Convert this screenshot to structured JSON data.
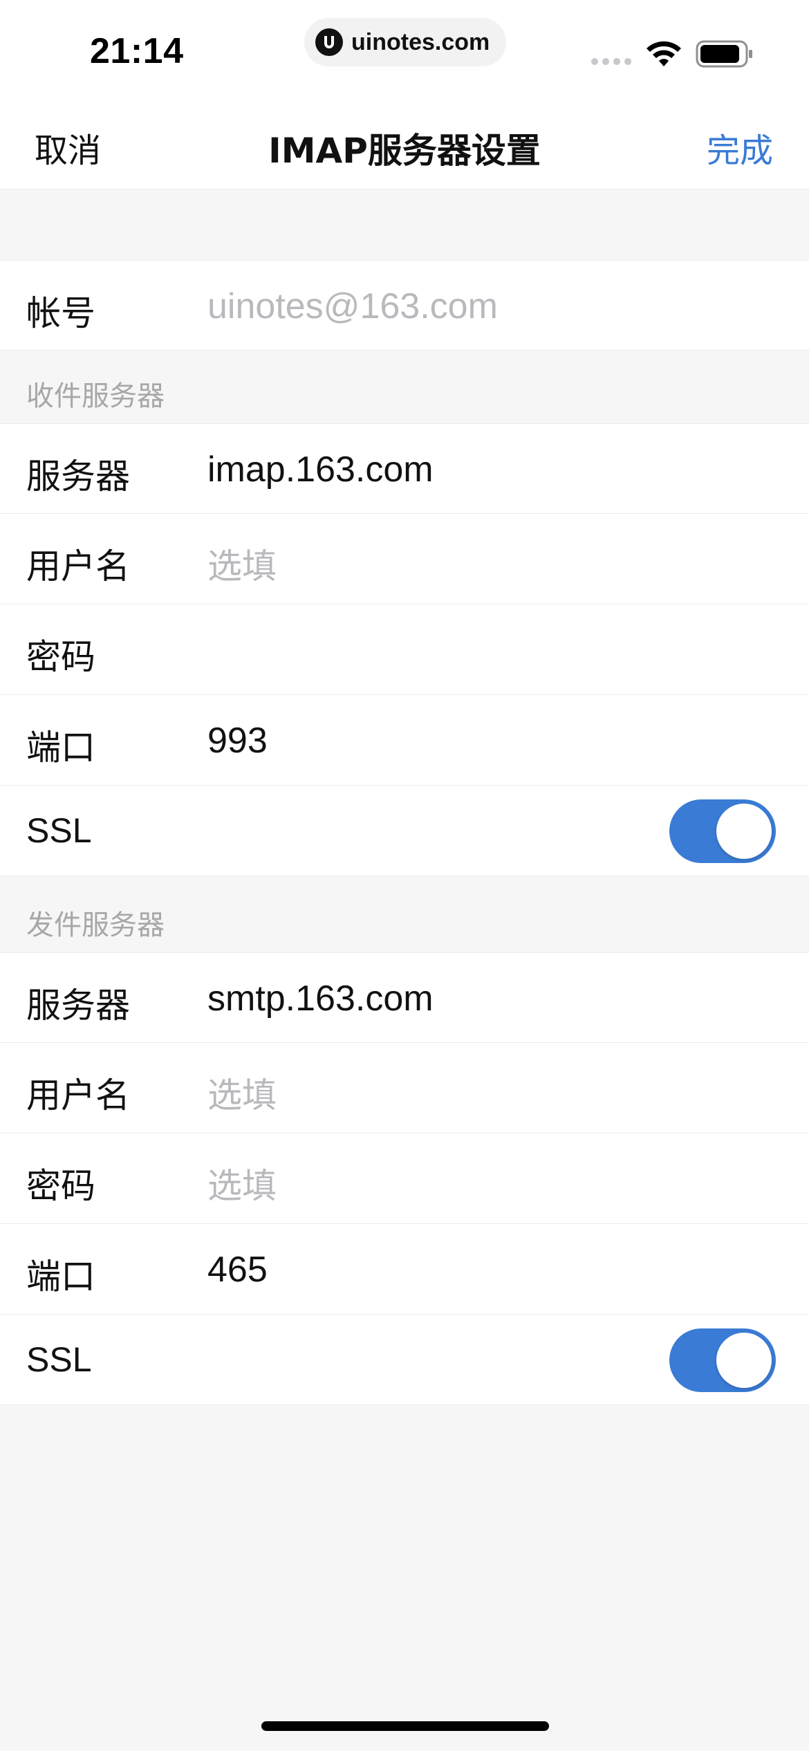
{
  "status_bar": {
    "time": "21:14",
    "url": "uinotes.com",
    "icons": [
      "signal-icon",
      "wifi-icon",
      "battery-icon"
    ]
  },
  "nav": {
    "cancel_label": "取消",
    "title": "IMAP服务器设置",
    "done_label": "完成",
    "accent_color": "#3a7bd5"
  },
  "account": {
    "label": "帐号",
    "value": "uinotes@163.com"
  },
  "incoming": {
    "header": "收件服务器",
    "server_label": "服务器",
    "server_value": "imap.163.com",
    "username_label": "用户名",
    "username_placeholder": "选填",
    "password_label": "密码",
    "port_label": "端口",
    "port_value": "993",
    "ssl_label": "SSL",
    "ssl_on": true
  },
  "outgoing": {
    "header": "发件服务器",
    "server_label": "服务器",
    "server_value": "smtp.163.com",
    "username_label": "用户名",
    "username_placeholder": "选填",
    "password_label": "密码",
    "password_placeholder": "选填",
    "port_label": "端口",
    "port_value": "465",
    "ssl_label": "SSL",
    "ssl_on": true
  }
}
